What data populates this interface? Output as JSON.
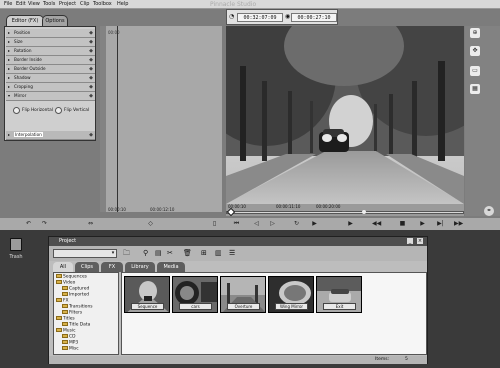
{
  "menubar": {
    "items": [
      "File",
      "Edit",
      "View",
      "Tools",
      "Project",
      "Clip",
      "Toolbox",
      "Help"
    ],
    "app_title": "Pinnacle Studio"
  },
  "editor": {
    "tabs": [
      "Editor (FX)",
      "Options"
    ],
    "panel_rows": [
      "Position",
      "Size",
      "Rotation",
      "Border Inside",
      "Border Outside",
      "Shadow",
      "Cropping",
      "Mirror"
    ],
    "mirror_options": [
      "Flip Horizontal",
      "Flip Vertical"
    ],
    "bottom_row": "Interpolation",
    "ruler_left": [
      "00:00:10",
      "00:00:12:10"
    ],
    "timecodes": [
      "00:32:07:09",
      "00:00:27:10"
    ],
    "preview_ruler": [
      "00:00:10",
      "00:00:11:10",
      "00:00:20:00"
    ]
  },
  "trash": {
    "label": "Trash"
  },
  "project": {
    "title": "Project",
    "tabs": [
      "All",
      "Clips",
      "FX",
      "Library",
      "Media"
    ],
    "tree": [
      {
        "label": "Sequences",
        "level": 0
      },
      {
        "label": "Video",
        "level": 0
      },
      {
        "label": "Captured",
        "level": 1
      },
      {
        "label": "Imported",
        "level": 1
      },
      {
        "label": "FX",
        "level": 0
      },
      {
        "label": "Transitions",
        "level": 1
      },
      {
        "label": "Filters",
        "level": 1
      },
      {
        "label": "Titles",
        "level": 0
      },
      {
        "label": "Title Data",
        "level": 1
      },
      {
        "label": "Music",
        "level": 0
      },
      {
        "label": "CD",
        "level": 1
      },
      {
        "label": "MP3",
        "level": 1
      },
      {
        "label": "Misc",
        "level": 1
      }
    ],
    "clips": [
      "Sequence",
      "cars",
      "Overture",
      "Wing Mirror",
      "Exit"
    ],
    "status_label": "Items:",
    "status_count": "5"
  }
}
